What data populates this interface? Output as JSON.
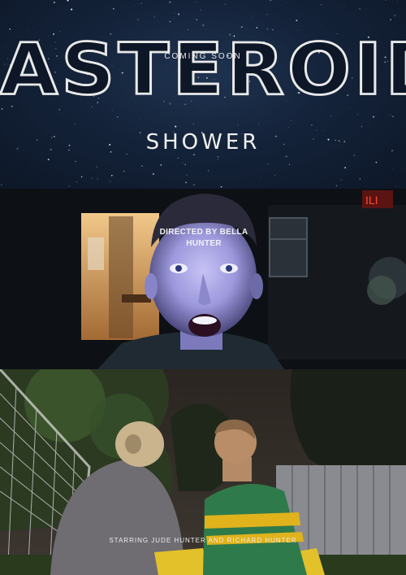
{
  "poster": {
    "title": "ASTEROID",
    "subtitle": "SHOWER",
    "tagline": "COMING SOON",
    "director_credit": "DIRECTED BY BELLA\nHUNTER",
    "starring_credit": "STARRING JUDE HUNTER AND RICHARD HUNTER"
  },
  "colors": {
    "sky": "#14233a",
    "title_outline": "#e9e9e9",
    "face_light": "#a9a6e6",
    "jersey_green": "#2f7a4a",
    "jersey_stripe": "#e0b21c"
  }
}
